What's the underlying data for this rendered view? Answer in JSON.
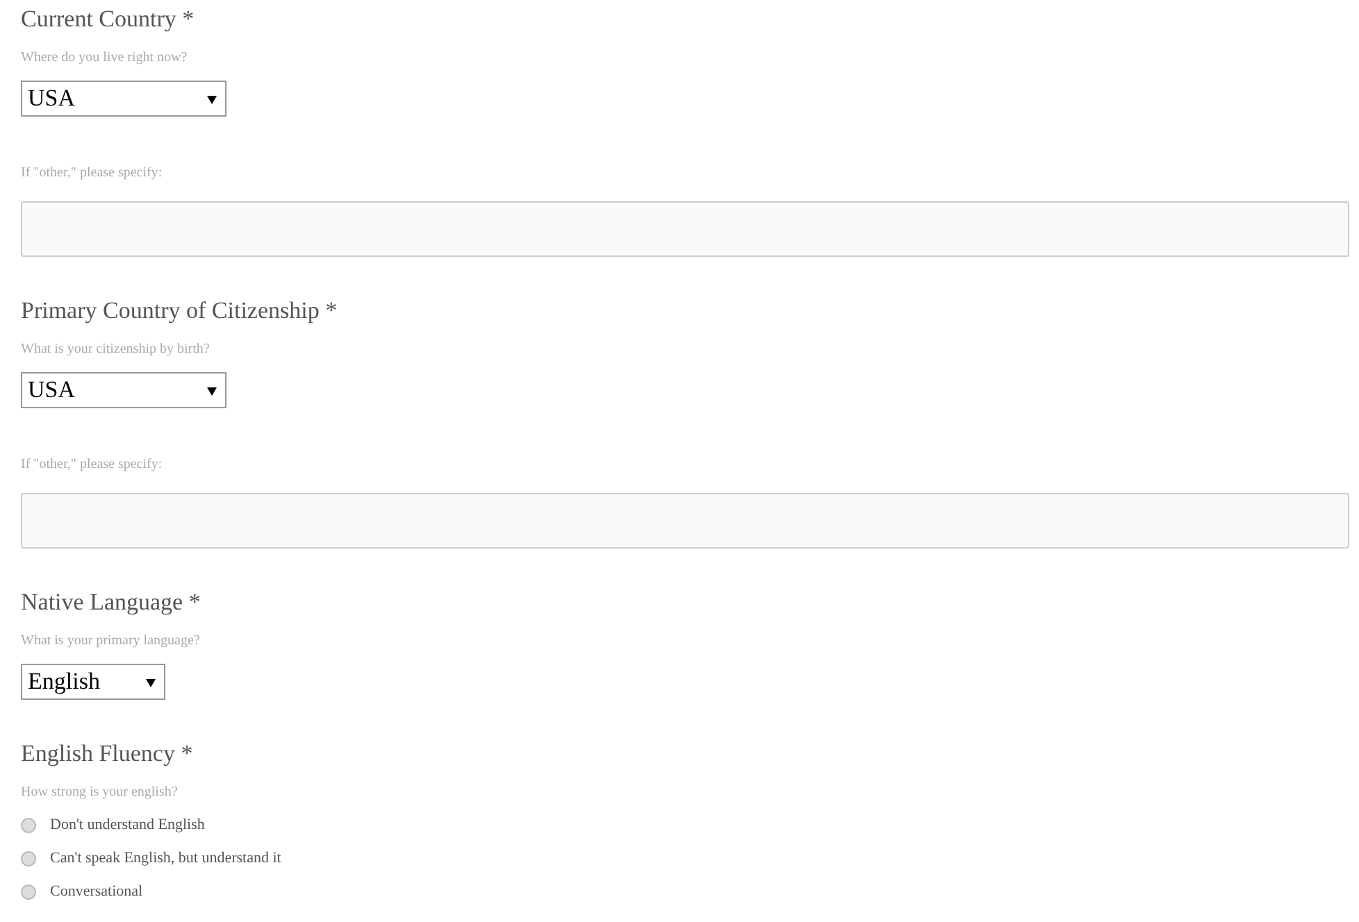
{
  "questions": [
    {
      "kind": "select",
      "label": "Current Country *",
      "hint": "Where do you live right now?",
      "value": "USA",
      "other": {
        "label": "If \"other,\" please specify:"
      }
    },
    {
      "kind": "select",
      "label": "Primary Country of Citizenship *",
      "hint": "What is your citizenship by birth?",
      "value": "USA",
      "other": {
        "label": "If \"other,\" please specify:"
      }
    },
    {
      "kind": "select",
      "label": "Native Language *",
      "hint": "What is your primary language?",
      "value": "English"
    },
    {
      "kind": "radio",
      "label": "English Fluency *",
      "hint": "How strong is your english?",
      "options": [
        {
          "label": "Don't understand English",
          "selected": false
        },
        {
          "label": "Can't speak English, but understand it",
          "selected": false
        },
        {
          "label": "Conversational",
          "selected": false
        }
      ]
    }
  ]
}
